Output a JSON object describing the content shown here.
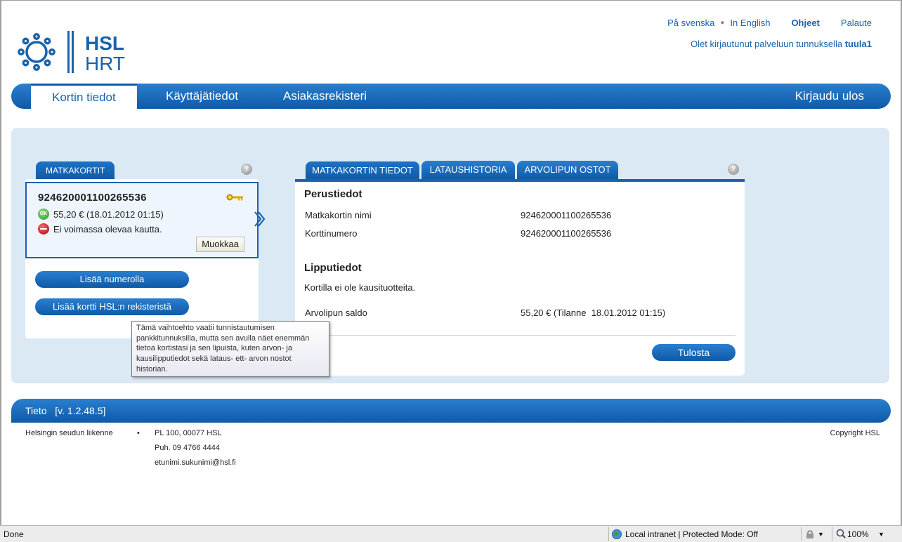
{
  "header": {
    "logo_text_top": "HSL",
    "logo_text_bottom": "HRT",
    "links": {
      "swedish": "På svenska",
      "english": "In English",
      "help": "Ohjeet",
      "feedback": "Palaute"
    },
    "login_text": "Olet kirjautunut palveluun tunnuksella",
    "username": "tuula1"
  },
  "nav": {
    "tabs": [
      "Kortin tiedot",
      "Käyttäjätiedot",
      "Asiakasrekisteri"
    ],
    "active_tab": "Kortin tiedot",
    "logout": "Kirjaudu ulos"
  },
  "cards_panel": {
    "tab_label": "MATKAKORTIT",
    "help_symbol": "?",
    "card": {
      "number": "924620001100265536",
      "status_ok_badge": "OK",
      "balance": "55,20 € (18.01.2012 01:15)",
      "season_status": "Ei voimassa olevaa kautta.",
      "edit_label": "Muokkaa"
    },
    "add_by_number": "Lisää numerolla",
    "add_from_registry": "Lisää kortti HSL:n rekisteristä"
  },
  "tooltip": {
    "text": "Tämä vaihtoehto vaatii tunnistautumisen pankkitunnuksilla, mutta sen avulla näet enemmän tietoa kortistasi ja sen lipuista, kuten arvon- ja kausilipputiedot sekä lataus- ett- arvon nostot historian."
  },
  "details_panel": {
    "tabs": [
      "MATKAKORTIN TIEDOT",
      "LATAUSHISTORIA",
      "ARVOLIPUN OSTOT"
    ],
    "active_tab": "MATKAKORTIN TIEDOT",
    "help_symbol": "?",
    "basic_heading": "Perustiedot",
    "card_name_label": "Matkakortin nimi",
    "card_name_value": "924620001100265536",
    "card_number_label": "Korttinumero",
    "card_number_value": "924620001100265536",
    "ticket_heading": "Lipputiedot",
    "no_season_text": "Kortilla ei ole kausituotteita.",
    "value_balance_label": "Arvolipun saldo",
    "value_balance_value": "55,20 € (Tilanne  18.01.2012 01:15)",
    "print_label": "Tulosta"
  },
  "footer": {
    "bar_text": "Tieto   [v. 1.2.48.5]",
    "org": "Helsingin seudun liikenne",
    "bullet": "•",
    "address": "PL 100, 00077 HSL",
    "phone": "Puh. 09 4766 4444",
    "email": "etunimi.sukunimi@hsl.fi",
    "copyright": "Copyright HSL"
  },
  "statusbar": {
    "left": "Done",
    "zone": "Local intranet | Protected Mode: Off",
    "zoom": "100%"
  },
  "colors": {
    "brand_blue": "#1b62aa",
    "panel_bg": "#dbe9f5",
    "ok_green": "#1f9a1f",
    "error_red": "#b00000"
  }
}
